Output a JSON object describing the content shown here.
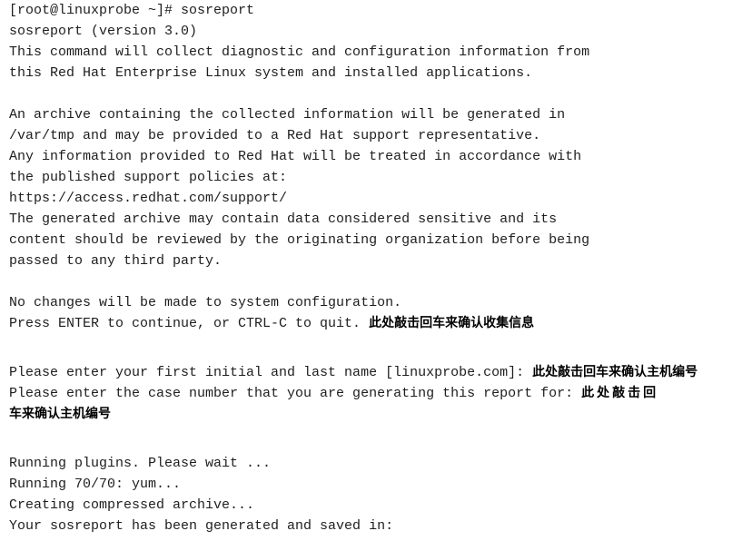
{
  "terminal": {
    "lines": [
      "[root@linuxprobe ~]# sosreport",
      "sosreport (version 3.0)",
      "This command will collect diagnostic and configuration information from",
      "this Red Hat Enterprise Linux system and installed applications.",
      "",
      "An archive containing the collected information will be generated in",
      "/var/tmp and may be provided to a Red Hat support representative.",
      "Any information provided to Red Hat will be treated in accordance with",
      "the published support policies at:",
      "https://access.redhat.com/support/",
      "The generated archive may contain data considered sensitive and its",
      "content should be reviewed by the originating organization before being",
      "passed to any third party.",
      "",
      "No changes will be made to system configuration.",
      "Press ENTER to continue, or CTRL-C to quit. ",
      "Please enter your first initial and last name [linuxprobe.com]: ",
      "Please enter the case number that you are generating this report for: ",
      "Running plugins. Please wait ...",
      "Running 70/70: yum...",
      "Creating compressed archive...",
      "Your sosreport has been generated and saved in:"
    ],
    "notes": {
      "enter": "此处敲击回车来确认收集信息",
      "hostname": "此处敲击回车来确认主机编号",
      "case_part1": "此处敲击回",
      "case_part2": "车来确认主机编号"
    }
  }
}
